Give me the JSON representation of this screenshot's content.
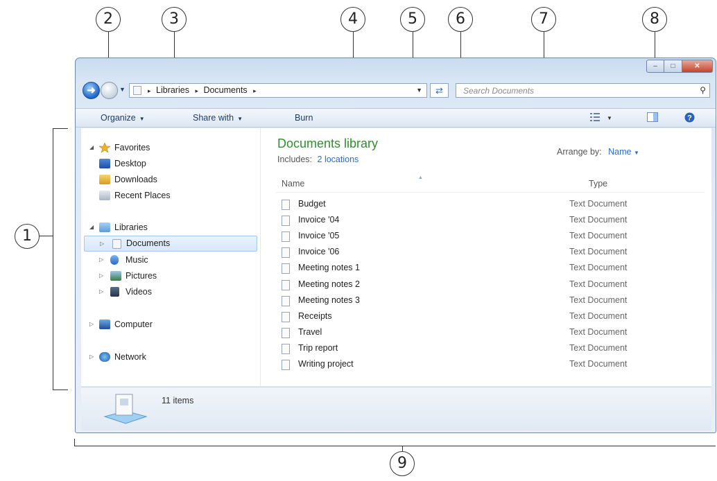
{
  "callouts": [
    "1",
    "2",
    "3",
    "4",
    "5",
    "6",
    "7",
    "8",
    "9"
  ],
  "window": {
    "address": {
      "crumbs": [
        "Libraries",
        "Documents"
      ],
      "separator": "▸"
    },
    "search": {
      "placeholder": "Search Documents",
      "icon": "search-icon"
    },
    "toolbar": {
      "organize": "Organize",
      "share_with": "Share with",
      "burn": "Burn"
    },
    "nav_pane": {
      "favorites": {
        "label": "Favorites",
        "items": [
          "Desktop",
          "Downloads",
          "Recent Places"
        ]
      },
      "libraries": {
        "label": "Libraries",
        "items": [
          "Documents",
          "Music",
          "Pictures",
          "Videos"
        ],
        "selected": "Documents"
      },
      "computer": "Computer",
      "network": "Network"
    },
    "content": {
      "title": "Documents library",
      "includes_label": "Includes:",
      "includes_link": "2 locations",
      "arrange_label": "Arrange by:",
      "arrange_value": "Name",
      "columns": [
        "Name",
        "Type"
      ],
      "files": [
        {
          "name": "Budget",
          "type": "Text Document"
        },
        {
          "name": "Invoice '04",
          "type": "Text Document"
        },
        {
          "name": "Invoice '05",
          "type": "Text Document"
        },
        {
          "name": "Invoice '06",
          "type": "Text Document"
        },
        {
          "name": "Meeting notes 1",
          "type": "Text Document"
        },
        {
          "name": "Meeting notes 2",
          "type": "Text Document"
        },
        {
          "name": "Meeting notes 3",
          "type": "Text Document"
        },
        {
          "name": "Receipts",
          "type": "Text Document"
        },
        {
          "name": "Travel",
          "type": "Text Document"
        },
        {
          "name": "Trip report",
          "type": "Text Document"
        },
        {
          "name": "Writing project",
          "type": "Text Document"
        }
      ]
    },
    "details": {
      "item_count": "11 items"
    }
  },
  "colors": {
    "library_title": "#2e8f2e",
    "link": "#2d6bc4",
    "close_button": "#c3442d"
  }
}
